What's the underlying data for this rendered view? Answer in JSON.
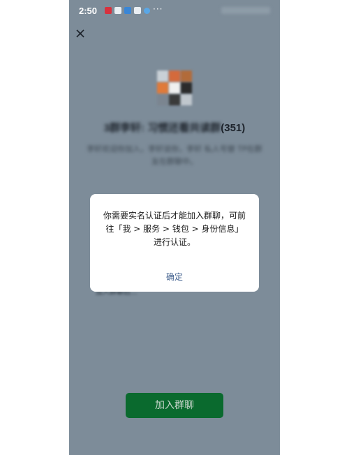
{
  "status_bar": {
    "time": "2:50",
    "more": "···",
    "notification_icons": [
      {
        "name": "notif-red-icon",
        "color": "#d7323e"
      },
      {
        "name": "notif-g-icon",
        "color": "#e9eef3"
      },
      {
        "name": "notif-blue-icon",
        "color": "#3a86d6"
      },
      {
        "name": "notif-q-icon",
        "color": "#e9eef3"
      },
      {
        "name": "notif-circle-icon",
        "color": "#5aa7e6"
      }
    ]
  },
  "header": {
    "close_icon": "close-icon"
  },
  "group": {
    "name_blurred": "3群李轩: 习惯还看共读群",
    "member_count": "(351)",
    "description_blurred": "李轩欢迎你加入，李轩说你，李轩 私人号替 TP在群友在群聊中。",
    "hidden_line": "加入群聊后..."
  },
  "dialog": {
    "message": "你需要实名认证后才能加入群聊，可前往「我 > 服务 > 钱包 > 身份信息」进行认证。",
    "ok_label": "确定"
  },
  "footer": {
    "join_button_label": "加入群聊"
  },
  "colors": {
    "background": "#7d8c99",
    "button": "#0a6a2e",
    "dialog_link": "#3b5b8a"
  }
}
